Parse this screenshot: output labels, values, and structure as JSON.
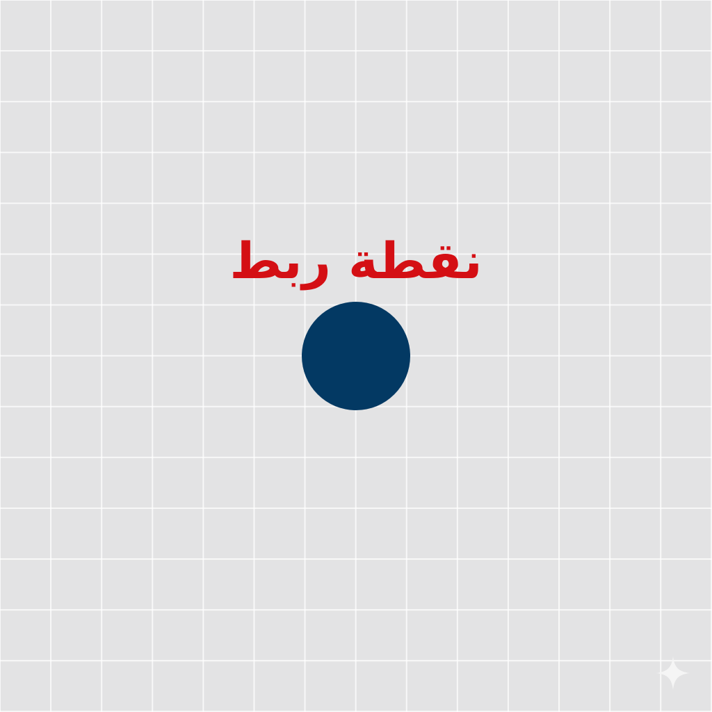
{
  "anchor_point": {
    "label": "نقطة ربط",
    "label_color": "#d40f14",
    "dot_color": "#033963"
  },
  "colors": {
    "background": "#e3e3e4",
    "grid": "#ffffff"
  },
  "watermark": {
    "icon": "sparkle-icon",
    "color": "#f5f5f5"
  }
}
